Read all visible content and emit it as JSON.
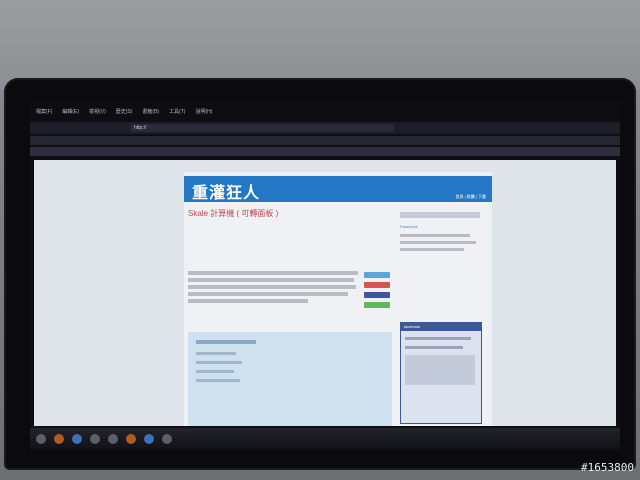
{
  "browser": {
    "menu_items": [
      "檔案(F)",
      "編輯(E)",
      "檢視(V)",
      "歷史(S)",
      "書籤(B)",
      "工具(T)",
      "說明(H)"
    ],
    "url": "http://"
  },
  "blog": {
    "banner_title": "重灌狂人",
    "nav": "首頁 | 軟體 | 下載",
    "post_title": "Skale 計算機 ( 可轉面板 )",
    "sidebar_link_1": "Facebook",
    "facebook_header": "facebook"
  },
  "colors": {
    "banner": "#2377c5",
    "post_title": "#c04a55",
    "facebook_blue": "#3b5998"
  },
  "taskbar": {
    "tray_text": ""
  },
  "watermark": "#1653800"
}
